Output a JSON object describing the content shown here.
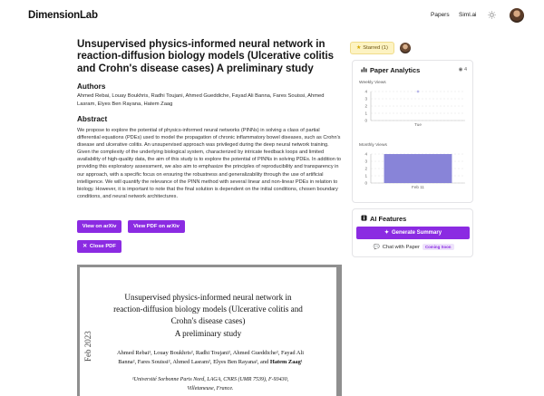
{
  "nav": {
    "logo": "DimensionLab",
    "links": [
      "Papers",
      "Siml.ai"
    ],
    "theme_icon": "sun-icon"
  },
  "paper": {
    "title": "Unsupervised physics-informed neural network in reaction-diffusion biology models (Ulcerative colitis and Crohn's disease cases) A preliminary study",
    "authors_heading": "Authors",
    "authors": "Ahmed Rebai, Louay Boukhris, Radhi Toujani, Ahmed Gueddiche, Fayad Ali Banna, Fares Souissi, Ahmed Lasram, Elyes Ben Rayana, Hatem Zaag",
    "abstract_heading": "Abstract",
    "abstract": "We propose to explore the potential of physics-informed neural networks (PINNs) in solving a class of partial differential equations (PDEs) used to model the propagation of chronic inflammatory bowel diseases, such as Crohn's disease and ulcerative colitis. An unsupervised approach was privileged during the deep neural network training. Given the complexity of the underlying biological system, characterized by intricate feedback loops and limited availability of high-quality data, the aim of this study is to explore the potential of PINNs in solving PDEs. In addition to providing this exploratory assessment, we also aim to emphasize the principles of reproducibility and transparency in our approach, with a specific focus on ensuring the robustness and generalizability through the use of artificial intelligence. We will quantify the relevance of the PINN method with several linear and non-linear PDEs in relation to biology. However, it is important to note that the final solution is dependent on the initial conditions, chosen boundary conditions, and neural network architectures."
  },
  "buttons": {
    "view_arxiv": "View on arXiv",
    "view_pdf": "View PDF on arXiv",
    "close_pdf": "Close PDF",
    "close_icon": "close-icon"
  },
  "pdf_preview": {
    "title_lines": [
      "Unsupervised physics-informed neural network in",
      "reaction-diffusion biology models (Ulcerative colitis and",
      "Crohn's disease cases)",
      "A preliminary study"
    ],
    "authors_line1": "Ahmed Rebai¹, Louay Boukhris², Radhi Toujani², Ahmed Gueddiche², Fayad Ali",
    "authors_line2_pre": "Banna², Fares Souissi², Ahmed Lasram², Elyes Ben Rayana², and ",
    "authors_line2_bold": "Hatem Zaag",
    "authors_line2_sup": "¹",
    "affil_line1": "¹Université Sorbonne Paris Nord, LAGA, CNRS (UMR 7539), F-93430,",
    "affil_line2": "Villetaneuse, France.",
    "side_stamp": "Feb 2023"
  },
  "sidebar": {
    "starred_label": "Starred",
    "starred_count": "(1)",
    "star_icon": "star-icon",
    "analytics_title": "Paper Analytics",
    "analytics_icon": "bar-chart-icon",
    "views_icon": "eye-icon",
    "views_count": "4",
    "ai_title": "AI Features",
    "ai_icon": "info-icon",
    "generate_summary": "Generate Summary",
    "generate_icon": "sparkle-icon",
    "chat_label": "Chat with Paper",
    "chat_icon": "chat-icon",
    "coming_soon": "Coming Soon"
  },
  "chart_data": [
    {
      "type": "scatter",
      "title": "Weekly Views",
      "categories": [
        "Tue"
      ],
      "values": [
        4
      ],
      "yticks": [
        0,
        1,
        2,
        3,
        4
      ],
      "ylim": [
        0,
        4
      ],
      "color": "#8884d8"
    },
    {
      "type": "bar",
      "title": "Monthly Views",
      "categories": [
        "Feb 11"
      ],
      "values": [
        4
      ],
      "yticks": [
        0,
        1,
        2,
        3,
        4
      ],
      "ylim": [
        0,
        4
      ],
      "color": "#8884d8"
    }
  ]
}
